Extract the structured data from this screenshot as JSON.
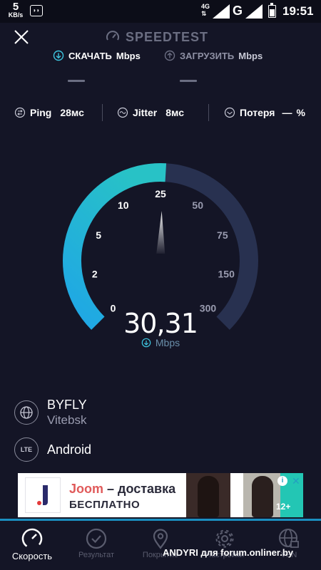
{
  "status_bar": {
    "net_speed": "5",
    "net_speed_unit": "KB/s",
    "network_type": "4G",
    "carrier_g": "G",
    "time": "19:51"
  },
  "header": {
    "title": "SPEEDTEST"
  },
  "modes": {
    "download": {
      "label": "СКАЧАТЬ",
      "unit": "Mbps",
      "value": "—"
    },
    "upload": {
      "label": "ЗАГРУЗИТЬ",
      "unit": "Mbps",
      "value": "—"
    }
  },
  "stats": {
    "ping": {
      "label": "Ping",
      "value": "28мс"
    },
    "jitter": {
      "label": "Jitter",
      "value": "8мс"
    },
    "loss": {
      "label": "Потеря",
      "value": "—",
      "unit": "%"
    }
  },
  "gauge": {
    "ticks": [
      "0",
      "2",
      "5",
      "10",
      "25",
      "50",
      "75",
      "150",
      "300"
    ],
    "speed": "30,31",
    "unit": "Mbps",
    "progress_tick_index": 4.1,
    "colors": {
      "filled": "#25b2d8",
      "track": "#283150",
      "needle": "#ffffff"
    }
  },
  "provider": {
    "isp": "BYFLY",
    "city": "Vitebsk",
    "device_badge": "LTE",
    "device": "Android"
  },
  "ad": {
    "brand": "Joom",
    "headline_rest": " – доставка",
    "subline": "БЕСПЛАТНО",
    "age": "12+"
  },
  "nav": {
    "items": [
      {
        "label": "Скорость",
        "icon": "speedometer-icon",
        "active": true
      },
      {
        "label": "Результат",
        "icon": "check-circle-icon",
        "active": false
      },
      {
        "label": "Покрытие",
        "icon": "map-pin-icon",
        "active": false
      },
      {
        "label": "Настройки",
        "icon": "gear-icon",
        "active": false
      },
      {
        "label": "VPN",
        "icon": "globe-lock-icon",
        "active": false
      }
    ]
  },
  "watermark": "ANDYRI для forum.onliner.by"
}
